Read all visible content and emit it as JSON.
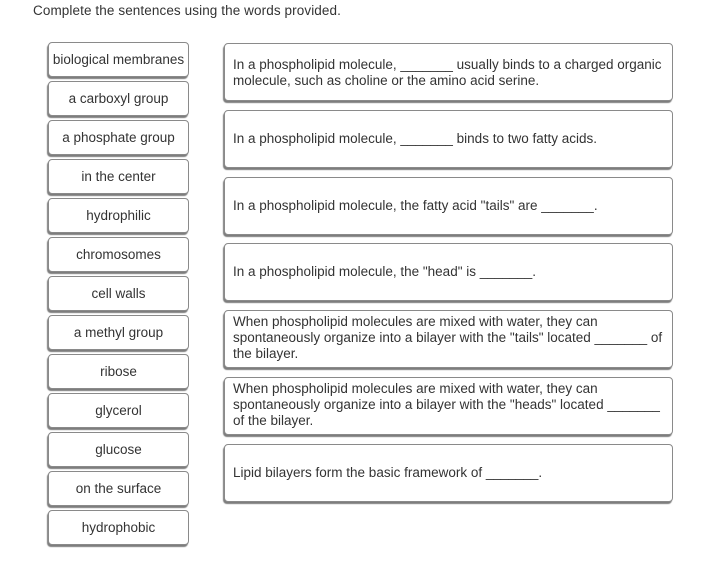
{
  "instructions": "Complete the sentences using the words provided.",
  "word_bank": [
    "biological membranes",
    "a carboxyl group",
    "a phosphate group",
    "in the center",
    "hydrophilic",
    "chromosomes",
    "cell walls",
    "a methyl group",
    "ribose",
    "glycerol",
    "glucose",
    "on the surface",
    "hydrophobic"
  ],
  "sentences": [
    "In a phospholipid molecule, _______ usually binds to a charged organic molecule, such as choline or the amino acid serine.",
    "In a phospholipid molecule, _______ binds to two fatty acids.",
    "In a phospholipid molecule, the fatty acid \"tails\" are _______.",
    "In a phospholipid molecule, the \"head\" is _______.",
    "When phospholipid molecules are mixed with water, they can spontaneously organize into a bilayer with the \"tails\" located _______ of the bilayer.",
    "When phospholipid molecules are mixed with water, they can spontaneously organize into a bilayer with the \"heads\" located _______ of the bilayer.",
    "Lipid bilayers form the basic framework of _______."
  ]
}
